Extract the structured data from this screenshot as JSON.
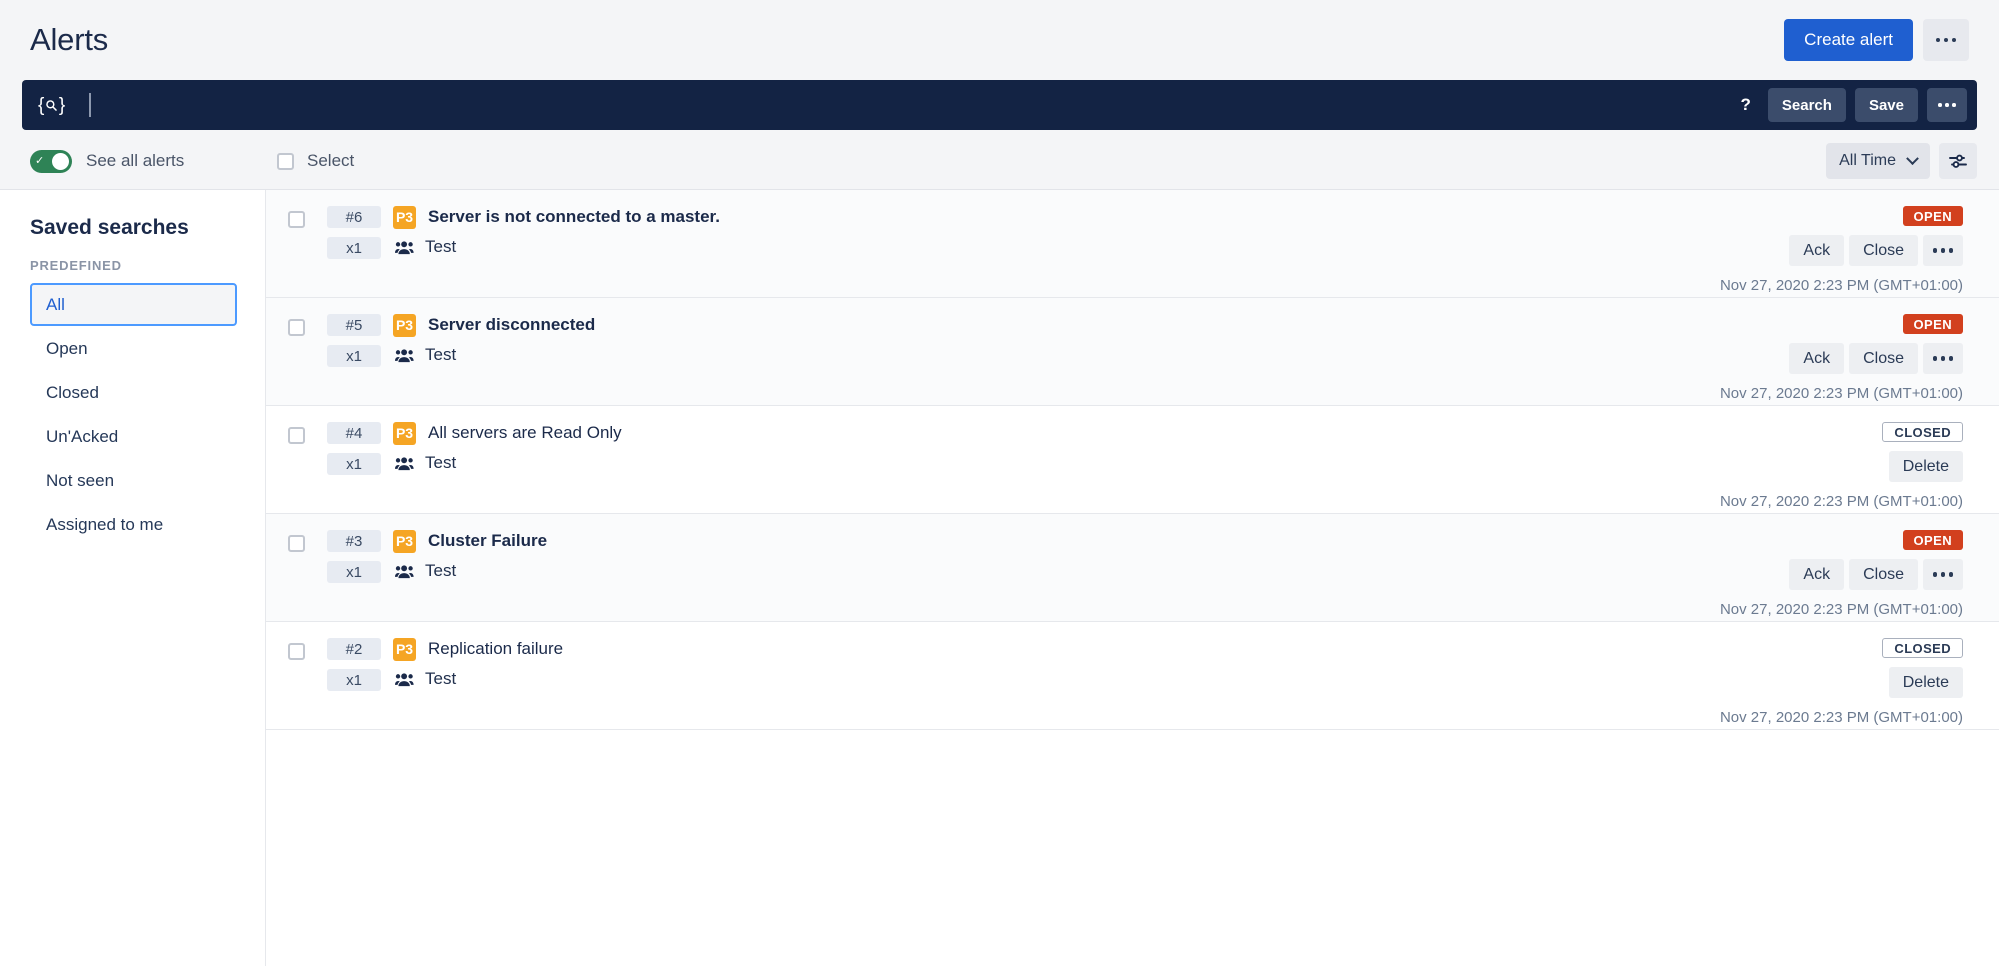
{
  "header": {
    "title": "Alerts",
    "create_alert_label": "Create alert",
    "more_icon": "ellipsis-icon"
  },
  "search": {
    "query_icon": "query-braces-search-icon",
    "value": "",
    "placeholder": "",
    "help_label": "?",
    "search_label": "Search",
    "save_label": "Save",
    "more_icon": "ellipsis-icon"
  },
  "toolbar": {
    "see_all_alerts_label": "See all alerts",
    "see_all_alerts_on": true,
    "select_label": "Select",
    "select_checked": false,
    "time_filter": "All Time",
    "filter_icon": "sliders-filter-icon"
  },
  "sidebar": {
    "title": "Saved searches",
    "section_label": "PREDEFINED",
    "items": [
      {
        "label": "All",
        "active": true
      },
      {
        "label": "Open",
        "active": false
      },
      {
        "label": "Closed",
        "active": false
      },
      {
        "label": "Un'Acked",
        "active": false
      },
      {
        "label": "Not seen",
        "active": false
      },
      {
        "label": "Assigned to me",
        "active": false
      }
    ]
  },
  "alerts": [
    {
      "id": "#6",
      "count": "x1",
      "priority": "P3",
      "title": "Server is not connected to a master.",
      "team": "Test",
      "status": "OPEN",
      "actions": [
        "Ack",
        "Close"
      ],
      "timestamp": "Nov 27, 2020 2:23 PM (GMT+01:00)"
    },
    {
      "id": "#5",
      "count": "x1",
      "priority": "P3",
      "title": "Server disconnected",
      "team": "Test",
      "status": "OPEN",
      "actions": [
        "Ack",
        "Close"
      ],
      "timestamp": "Nov 27, 2020 2:23 PM (GMT+01:00)"
    },
    {
      "id": "#4",
      "count": "x1",
      "priority": "P3",
      "title": "All servers are Read Only",
      "team": "Test",
      "status": "CLOSED",
      "actions": [
        "Delete"
      ],
      "timestamp": "Nov 27, 2020 2:23 PM (GMT+01:00)"
    },
    {
      "id": "#3",
      "count": "x1",
      "priority": "P3",
      "title": "Cluster Failure",
      "team": "Test",
      "status": "OPEN",
      "actions": [
        "Ack",
        "Close"
      ],
      "timestamp": "Nov 27, 2020 2:23 PM (GMT+01:00)"
    },
    {
      "id": "#2",
      "count": "x1",
      "priority": "P3",
      "title": "Replication failure",
      "team": "Test",
      "status": "CLOSED",
      "actions": [
        "Delete"
      ],
      "timestamp": "Nov 27, 2020 2:23 PM (GMT+01:00)"
    }
  ],
  "colors": {
    "brand_blue": "#1F5FD0",
    "search_navy": "#132344",
    "priority_amber": "#F5A524",
    "status_open_red": "#D2401E",
    "toggle_green": "#2E8356"
  }
}
